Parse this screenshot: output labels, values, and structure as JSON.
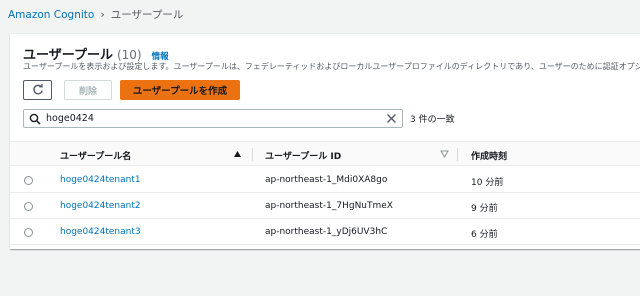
{
  "breadcrumb": {
    "parent": "Amazon Cognito",
    "separator": "›",
    "current": "ユーザープール"
  },
  "panel": {
    "title": "ユーザープール",
    "count": "(10)",
    "info": "情報",
    "description": "ユーザープールを表示および設定します。ユーザープールは、フェデレーティッドおよびローカルユーザープロファイルのディレクトリであり、ユーザーのために認証オプションを提供します。"
  },
  "toolbar": {
    "refresh_icon": "refresh-icon",
    "delete_label": "削除",
    "create_label": "ユーザープールを作成"
  },
  "search": {
    "value": "hoge0424",
    "match_text": "3 件の一致"
  },
  "table": {
    "headers": {
      "name": "ユーザープール名",
      "id": "ユーザープール ID",
      "created": "作成時刻"
    },
    "rows": [
      {
        "name": "hoge0424tenant1",
        "id": "ap-northeast-1_Mdi0XA8go",
        "created": "10 分前"
      },
      {
        "name": "hoge0424tenant2",
        "id": "ap-northeast-1_7HgNuTmeX",
        "created": "9 分前"
      },
      {
        "name": "hoge0424tenant3",
        "id": "ap-northeast-1_yDj6UV3hC",
        "created": "6 分前"
      }
    ]
  },
  "colors": {
    "link": "#0073bb",
    "primary": "#ec7211",
    "background": "#f2f3f3"
  }
}
